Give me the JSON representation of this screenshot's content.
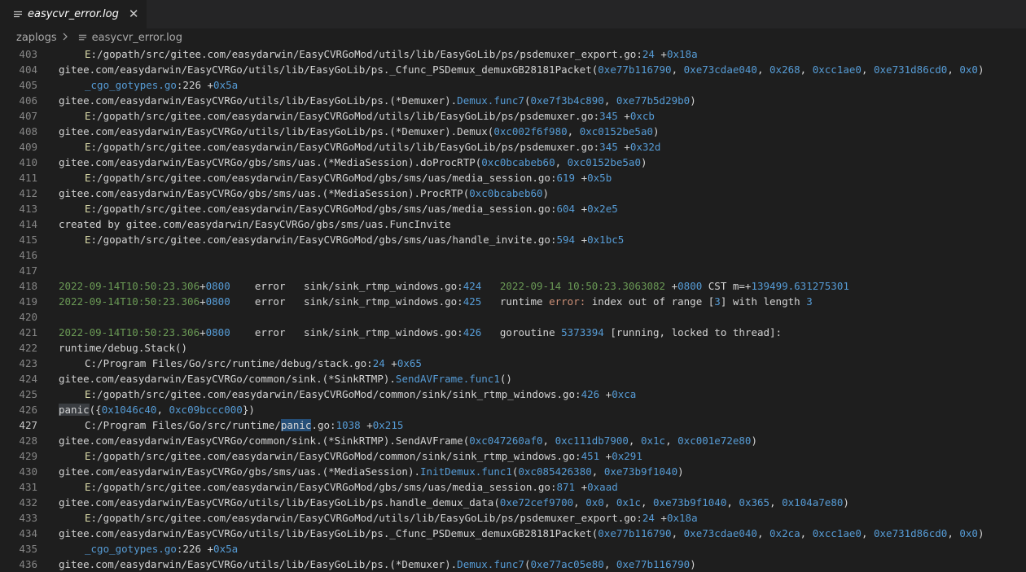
{
  "tab": {
    "title": "easycvr_error.log",
    "close": "✕"
  },
  "breadcrumbs": {
    "folder": "zaplogs",
    "file": "easycvr_error.log"
  },
  "lines": [
    {
      "n": "403",
      "segs": [
        [
          "indent",
          ""
        ],
        [
          "e-y",
          "E"
        ],
        [
          "t",
          ":/gopath/src/gitee.com/easydarwin/EasyCVRGoMod/utils/lib/EasyGoLib/ps/psdemuxer_export.go:"
        ],
        [
          "n",
          "24"
        ],
        [
          "t",
          " +"
        ],
        [
          "n",
          "0x18a"
        ]
      ]
    },
    {
      "n": "404",
      "segs": [
        [
          "t",
          "gitee.com/easydarwin/EasyCVRGo/utils/lib/EasyGoLib/ps._Cfunc_PSDemux_demuxGB28181Packet("
        ],
        [
          "n",
          "0xe77b116790"
        ],
        [
          "t",
          ", "
        ],
        [
          "n",
          "0xe73cdae040"
        ],
        [
          "t",
          ", "
        ],
        [
          "n",
          "0x268"
        ],
        [
          "t",
          ", "
        ],
        [
          "n",
          "0xcc1ae0"
        ],
        [
          "t",
          ", "
        ],
        [
          "n",
          "0xe731d86cd0"
        ],
        [
          "t",
          ", "
        ],
        [
          "n",
          "0x0"
        ],
        [
          "t",
          ")"
        ]
      ]
    },
    {
      "n": "405",
      "segs": [
        [
          "indent",
          ""
        ],
        [
          "n",
          "_cgo_gotypes.go"
        ],
        [
          "t",
          ":226 +"
        ],
        [
          "n",
          "0x5a"
        ]
      ]
    },
    {
      "n": "406",
      "segs": [
        [
          "t",
          "gitee.com/easydarwin/EasyCVRGo/utils/lib/EasyGoLib/ps.(*Demuxer)."
        ],
        [
          "fn",
          "Demux.func7"
        ],
        [
          "t",
          "("
        ],
        [
          "n",
          "0xe7f3b4c890"
        ],
        [
          "t",
          ", "
        ],
        [
          "n",
          "0xe77b5d29b0"
        ],
        [
          "t",
          ")"
        ]
      ]
    },
    {
      "n": "407",
      "segs": [
        [
          "indent",
          ""
        ],
        [
          "e-y",
          "E"
        ],
        [
          "t",
          ":/gopath/src/gitee.com/easydarwin/EasyCVRGoMod/utils/lib/EasyGoLib/ps/psdemuxer.go:"
        ],
        [
          "n",
          "345"
        ],
        [
          "t",
          " +"
        ],
        [
          "n",
          "0xcb"
        ]
      ]
    },
    {
      "n": "408",
      "segs": [
        [
          "t",
          "gitee.com/easydarwin/EasyCVRGo/utils/lib/EasyGoLib/ps.(*Demuxer).Demux("
        ],
        [
          "n",
          "0xc002f6f980"
        ],
        [
          "t",
          ", "
        ],
        [
          "n",
          "0xc0152be5a0"
        ],
        [
          "t",
          ")"
        ]
      ]
    },
    {
      "n": "409",
      "segs": [
        [
          "indent",
          ""
        ],
        [
          "e-y",
          "E"
        ],
        [
          "t",
          ":/gopath/src/gitee.com/easydarwin/EasyCVRGoMod/utils/lib/EasyGoLib/ps/psdemuxer.go:"
        ],
        [
          "n",
          "345"
        ],
        [
          "t",
          " +"
        ],
        [
          "n",
          "0x32d"
        ]
      ]
    },
    {
      "n": "410",
      "segs": [
        [
          "t",
          "gitee.com/easydarwin/EasyCVRGo/gbs/sms/uas.(*MediaSession).doProcRTP("
        ],
        [
          "n",
          "0xc0bcabeb60"
        ],
        [
          "t",
          ", "
        ],
        [
          "n",
          "0xc0152be5a0"
        ],
        [
          "t",
          ")"
        ]
      ]
    },
    {
      "n": "411",
      "segs": [
        [
          "indent",
          ""
        ],
        [
          "e-y",
          "E"
        ],
        [
          "t",
          ":/gopath/src/gitee.com/easydarwin/EasyCVRGoMod/gbs/sms/uas/media_session.go:"
        ],
        [
          "n",
          "619"
        ],
        [
          "t",
          " +"
        ],
        [
          "n",
          "0x5b"
        ]
      ]
    },
    {
      "n": "412",
      "segs": [
        [
          "t",
          "gitee.com/easydarwin/EasyCVRGo/gbs/sms/uas.(*MediaSession).ProcRTP("
        ],
        [
          "n",
          "0xc0bcabeb60"
        ],
        [
          "t",
          ")"
        ]
      ]
    },
    {
      "n": "413",
      "segs": [
        [
          "indent",
          ""
        ],
        [
          "e-y",
          "E"
        ],
        [
          "t",
          ":/gopath/src/gitee.com/easydarwin/EasyCVRGoMod/gbs/sms/uas/media_session.go:"
        ],
        [
          "n",
          "604"
        ],
        [
          "t",
          " +"
        ],
        [
          "n",
          "0x2e5"
        ]
      ]
    },
    {
      "n": "414",
      "segs": [
        [
          "t",
          "created by gitee.com/easydarwin/EasyCVRGo/gbs/sms/uas.FuncInvite"
        ]
      ]
    },
    {
      "n": "415",
      "segs": [
        [
          "indent",
          ""
        ],
        [
          "e-y",
          "E"
        ],
        [
          "t",
          ":/gopath/src/gitee.com/easydarwin/EasyCVRGoMod/gbs/sms/uas/handle_invite.go:"
        ],
        [
          "n",
          "594"
        ],
        [
          "t",
          " +"
        ],
        [
          "n",
          "0x1bc5"
        ]
      ]
    },
    {
      "n": "416",
      "segs": []
    },
    {
      "n": "417",
      "segs": []
    },
    {
      "n": "418",
      "segs": [
        [
          "dt",
          "2022-09-14T10:50:23.306"
        ],
        [
          "t",
          "+"
        ],
        [
          "n",
          "0800"
        ],
        [
          "t",
          "    error   sink/sink_rtmp_windows.go:"
        ],
        [
          "n",
          "424"
        ],
        [
          "t",
          "   "
        ],
        [
          "dt",
          "2022-09-14 10:50:23.3063082"
        ],
        [
          "t",
          " +"
        ],
        [
          "n",
          "0800"
        ],
        [
          "t",
          " CST m=+"
        ],
        [
          "n",
          "139499.631275301"
        ]
      ]
    },
    {
      "n": "419",
      "segs": [
        [
          "dt",
          "2022-09-14T10:50:23.306"
        ],
        [
          "t",
          "+"
        ],
        [
          "n",
          "0800"
        ],
        [
          "t",
          "    error   sink/sink_rtmp_windows.go:"
        ],
        [
          "n",
          "425"
        ],
        [
          "t",
          "   runtime "
        ],
        [
          "err",
          "error:"
        ],
        [
          "t",
          " index out of range ["
        ],
        [
          "n",
          "3"
        ],
        [
          "t",
          "] with length "
        ],
        [
          "n",
          "3"
        ]
      ]
    },
    {
      "n": "420",
      "segs": []
    },
    {
      "n": "421",
      "segs": [
        [
          "dt",
          "2022-09-14T10:50:23.306"
        ],
        [
          "t",
          "+"
        ],
        [
          "n",
          "0800"
        ],
        [
          "t",
          "    error   sink/sink_rtmp_windows.go:"
        ],
        [
          "n",
          "426"
        ],
        [
          "t",
          "   goroutine "
        ],
        [
          "n",
          "5373394"
        ],
        [
          "t",
          " [running, locked to thread]:"
        ]
      ]
    },
    {
      "n": "422",
      "segs": [
        [
          "t",
          "runtime/debug.Stack()"
        ]
      ]
    },
    {
      "n": "423",
      "segs": [
        [
          "indent",
          ""
        ],
        [
          "t",
          "C:/Program Files/Go/src/runtime/debug/stack.go:"
        ],
        [
          "n",
          "24"
        ],
        [
          "t",
          " +"
        ],
        [
          "n",
          "0x65"
        ]
      ]
    },
    {
      "n": "424",
      "segs": [
        [
          "t",
          "gitee.com/easydarwin/EasyCVRGo/common/sink.(*SinkRTMP)."
        ],
        [
          "fn",
          "SendAVFrame.func1"
        ],
        [
          "t",
          "()"
        ]
      ]
    },
    {
      "n": "425",
      "segs": [
        [
          "indent",
          ""
        ],
        [
          "e-y",
          "E"
        ],
        [
          "t",
          ":/gopath/src/gitee.com/easydarwin/EasyCVRGoMod/common/sink/sink_rtmp_windows.go:"
        ],
        [
          "n",
          "426"
        ],
        [
          "t",
          " +"
        ],
        [
          "n",
          "0xca"
        ]
      ]
    },
    {
      "n": "426",
      "segs": [
        [
          "hl2",
          "panic"
        ],
        [
          "t",
          "({"
        ],
        [
          "n",
          "0x1046c40"
        ],
        [
          "t",
          ", "
        ],
        [
          "n",
          "0xc09bccc000"
        ],
        [
          "t",
          "})"
        ]
      ]
    },
    {
      "n": "427",
      "current": true,
      "segs": [
        [
          "indent",
          ""
        ],
        [
          "t",
          "C:/Program Files/Go/src/runtime/"
        ],
        [
          "hl",
          "panic"
        ],
        [
          "t",
          ".go:"
        ],
        [
          "n",
          "1038"
        ],
        [
          "t",
          " +"
        ],
        [
          "n",
          "0x215"
        ]
      ]
    },
    {
      "n": "428",
      "segs": [
        [
          "t",
          "gitee.com/easydarwin/EasyCVRGo/common/sink.(*SinkRTMP).SendAVFrame("
        ],
        [
          "n",
          "0xc047260af0"
        ],
        [
          "t",
          ", "
        ],
        [
          "n",
          "0xc111db7900"
        ],
        [
          "t",
          ", "
        ],
        [
          "n",
          "0x1c"
        ],
        [
          "t",
          ", "
        ],
        [
          "n",
          "0xc001e72e80"
        ],
        [
          "t",
          ")"
        ]
      ]
    },
    {
      "n": "429",
      "segs": [
        [
          "indent",
          ""
        ],
        [
          "e-y",
          "E"
        ],
        [
          "t",
          ":/gopath/src/gitee.com/easydarwin/EasyCVRGoMod/common/sink/sink_rtmp_windows.go:"
        ],
        [
          "n",
          "451"
        ],
        [
          "t",
          " +"
        ],
        [
          "n",
          "0x291"
        ]
      ]
    },
    {
      "n": "430",
      "segs": [
        [
          "t",
          "gitee.com/easydarwin/EasyCVRGo/gbs/sms/uas.(*MediaSession)."
        ],
        [
          "fn",
          "InitDemux.func1"
        ],
        [
          "t",
          "("
        ],
        [
          "n",
          "0xc085426380"
        ],
        [
          "t",
          ", "
        ],
        [
          "n",
          "0xe73b9f1040"
        ],
        [
          "t",
          ")"
        ]
      ]
    },
    {
      "n": "431",
      "segs": [
        [
          "indent",
          ""
        ],
        [
          "e-y",
          "E"
        ],
        [
          "t",
          ":/gopath/src/gitee.com/easydarwin/EasyCVRGoMod/gbs/sms/uas/media_session.go:"
        ],
        [
          "n",
          "871"
        ],
        [
          "t",
          " +"
        ],
        [
          "n",
          "0xaad"
        ]
      ]
    },
    {
      "n": "432",
      "segs": [
        [
          "t",
          "gitee.com/easydarwin/EasyCVRGo/utils/lib/EasyGoLib/ps.handle_demux_data("
        ],
        [
          "n",
          "0xe72cef9700"
        ],
        [
          "t",
          ", "
        ],
        [
          "n",
          "0x0"
        ],
        [
          "t",
          ", "
        ],
        [
          "n",
          "0x1c"
        ],
        [
          "t",
          ", "
        ],
        [
          "n",
          "0xe73b9f1040"
        ],
        [
          "t",
          ", "
        ],
        [
          "n",
          "0x365"
        ],
        [
          "t",
          ", "
        ],
        [
          "n",
          "0x104a7e80"
        ],
        [
          "t",
          ")"
        ]
      ]
    },
    {
      "n": "433",
      "segs": [
        [
          "indent",
          ""
        ],
        [
          "e-y",
          "E"
        ],
        [
          "t",
          ":/gopath/src/gitee.com/easydarwin/EasyCVRGoMod/utils/lib/EasyGoLib/ps/psdemuxer_export.go:"
        ],
        [
          "n",
          "24"
        ],
        [
          "t",
          " +"
        ],
        [
          "n",
          "0x18a"
        ]
      ]
    },
    {
      "n": "434",
      "segs": [
        [
          "t",
          "gitee.com/easydarwin/EasyCVRGo/utils/lib/EasyGoLib/ps._Cfunc_PSDemux_demuxGB28181Packet("
        ],
        [
          "n",
          "0xe77b116790"
        ],
        [
          "t",
          ", "
        ],
        [
          "n",
          "0xe73cdae040"
        ],
        [
          "t",
          ", "
        ],
        [
          "n",
          "0x2ca"
        ],
        [
          "t",
          ", "
        ],
        [
          "n",
          "0xcc1ae0"
        ],
        [
          "t",
          ", "
        ],
        [
          "n",
          "0xe731d86cd0"
        ],
        [
          "t",
          ", "
        ],
        [
          "n",
          "0x0"
        ],
        [
          "t",
          ")"
        ]
      ]
    },
    {
      "n": "435",
      "segs": [
        [
          "indent",
          ""
        ],
        [
          "n",
          "_cgo_gotypes.go"
        ],
        [
          "t",
          ":226 +"
        ],
        [
          "n",
          "0x5a"
        ]
      ]
    },
    {
      "n": "436",
      "segs": [
        [
          "t",
          "gitee.com/easydarwin/EasyCVRGo/utils/lib/EasyGoLib/ps.(*Demuxer)."
        ],
        [
          "fn",
          "Demux.func7"
        ],
        [
          "t",
          "("
        ],
        [
          "n",
          "0xe77ac05e80"
        ],
        [
          "t",
          ", "
        ],
        [
          "n",
          "0xe77b116790"
        ],
        [
          "t",
          ")"
        ]
      ]
    }
  ]
}
